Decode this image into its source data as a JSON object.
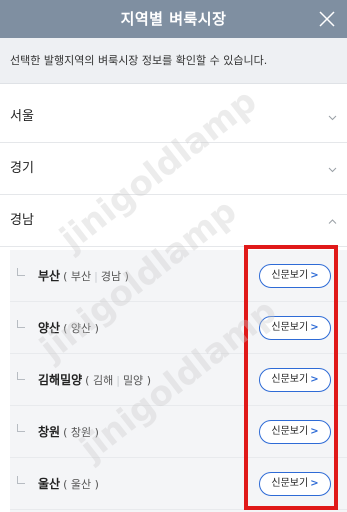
{
  "header": {
    "title": "지역별 벼룩시장"
  },
  "info": {
    "text": "선택한 발행지역의 벼룩시장 정보를 확인할 수 있습니다."
  },
  "regions": [
    {
      "label": "서울",
      "expanded": false
    },
    {
      "label": "경기",
      "expanded": false
    },
    {
      "label": "경남",
      "expanded": true
    }
  ],
  "subregions": [
    {
      "name": "부산",
      "detail_open": "(",
      "areas": [
        "부산",
        "경남"
      ],
      "detail_close": ")",
      "button": "신문보기",
      "arrow": ">"
    },
    {
      "name": "양산",
      "detail_open": "(",
      "areas": [
        "양산"
      ],
      "detail_close": ")",
      "button": "신문보기",
      "arrow": ">"
    },
    {
      "name": "김해밀양",
      "detail_open": "(",
      "areas": [
        "김해",
        "밀양"
      ],
      "detail_close": ")",
      "button": "신문보기",
      "arrow": ">"
    },
    {
      "name": "창원",
      "detail_open": "(",
      "areas": [
        "창원"
      ],
      "detail_close": ")",
      "button": "신문보기",
      "arrow": ">"
    },
    {
      "name": "울산",
      "detail_open": "(",
      "areas": [
        "울산"
      ],
      "detail_close": ")",
      "button": "신문보기",
      "arrow": ">"
    }
  ],
  "watermark": {
    "text": "jinigoldlamp"
  },
  "colors": {
    "header_bg": "#7f8fa1",
    "button_border": "#2e6bd6",
    "highlight": "#e01919",
    "info_bg": "#eef0f3"
  }
}
